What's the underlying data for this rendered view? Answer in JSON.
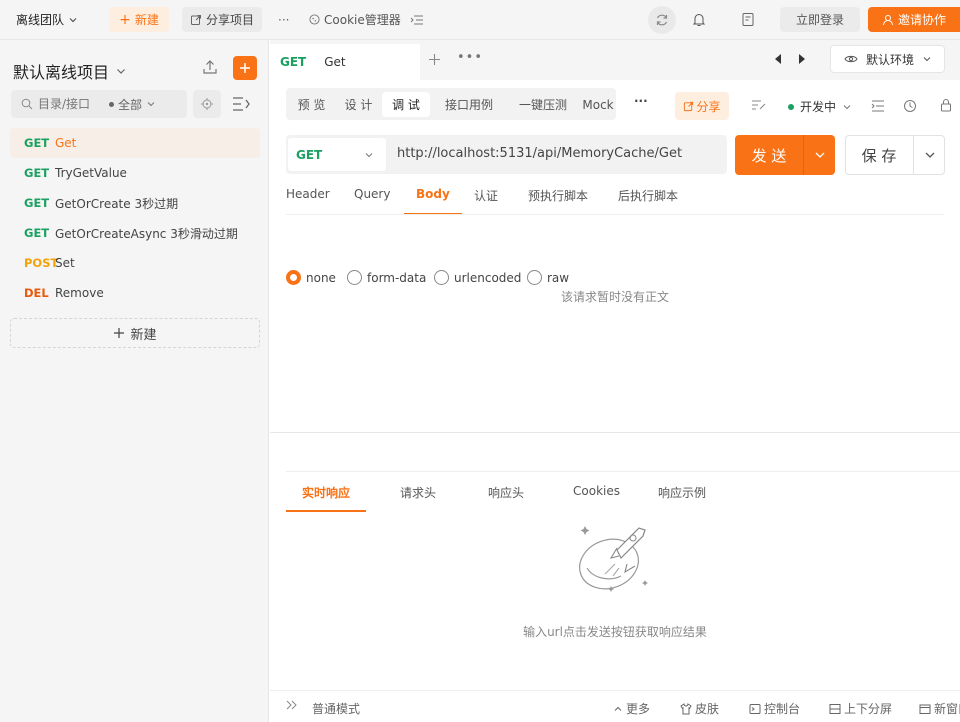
{
  "topbar": {
    "team": "离线团队",
    "new": "新建",
    "share_project": "分享项目",
    "more": "···",
    "cookie_manager": "Cookie管理器",
    "login": "立即登录",
    "invite": "邀请协作"
  },
  "sidebar": {
    "project_title": "默认离线项目",
    "search_placeholder": "目录/接口",
    "filter_all": "全部",
    "new_label": "新建",
    "apis": [
      {
        "method": "GET",
        "name": "Get",
        "color": "#1aa060",
        "active": true
      },
      {
        "method": "GET",
        "name": "TryGetValue",
        "color": "#1aa060"
      },
      {
        "method": "GET",
        "name": "GetOrCreate 3秒过期",
        "color": "#1aa060"
      },
      {
        "method": "GET",
        "name": "GetOrCreateAsync 3秒滑动过期",
        "color": "#1aa060"
      },
      {
        "method": "POST",
        "name": "Set",
        "color": "#f5a10a"
      },
      {
        "method": "DEL",
        "name": "Remove",
        "color": "#e8590c"
      }
    ]
  },
  "main": {
    "doc_tab": {
      "method": "GET",
      "name": "Get"
    },
    "env": "默认环境",
    "content_tabs": [
      "预 览",
      "设 计",
      "调 试",
      "接口用例",
      "一键压测",
      "Mock"
    ],
    "active_content_tab": 2,
    "share": "分享",
    "dev_env": "开发中",
    "request": {
      "method": "GET",
      "url": "http://localhost:5131/api/MemoryCache/Get",
      "send": "发 送",
      "save": "保 存"
    },
    "param_tabs": [
      "Header",
      "Query",
      "Body",
      "认证",
      "预执行脚本",
      "后执行脚本"
    ],
    "active_param_tab": 2,
    "body_types": [
      "none",
      "form-data",
      "urlencoded",
      "raw"
    ],
    "selected_body_type": 0,
    "body_empty": "该请求暂时没有正文",
    "response_tabs": [
      "实时响应",
      "请求头",
      "响应头",
      "Cookies",
      "响应示例"
    ],
    "active_response_tab": 0,
    "response_empty": "输入url点击发送按钮获取响应结果"
  },
  "statusbar": {
    "mode": "普通模式",
    "more": "更多",
    "skin": "皮肤",
    "console": "控制台",
    "split": "上下分屏",
    "new_window": "新窗口"
  },
  "colors": {
    "accent": "#f97316",
    "get": "#1aa060",
    "post": "#f5a10a",
    "del": "#e8590c"
  }
}
